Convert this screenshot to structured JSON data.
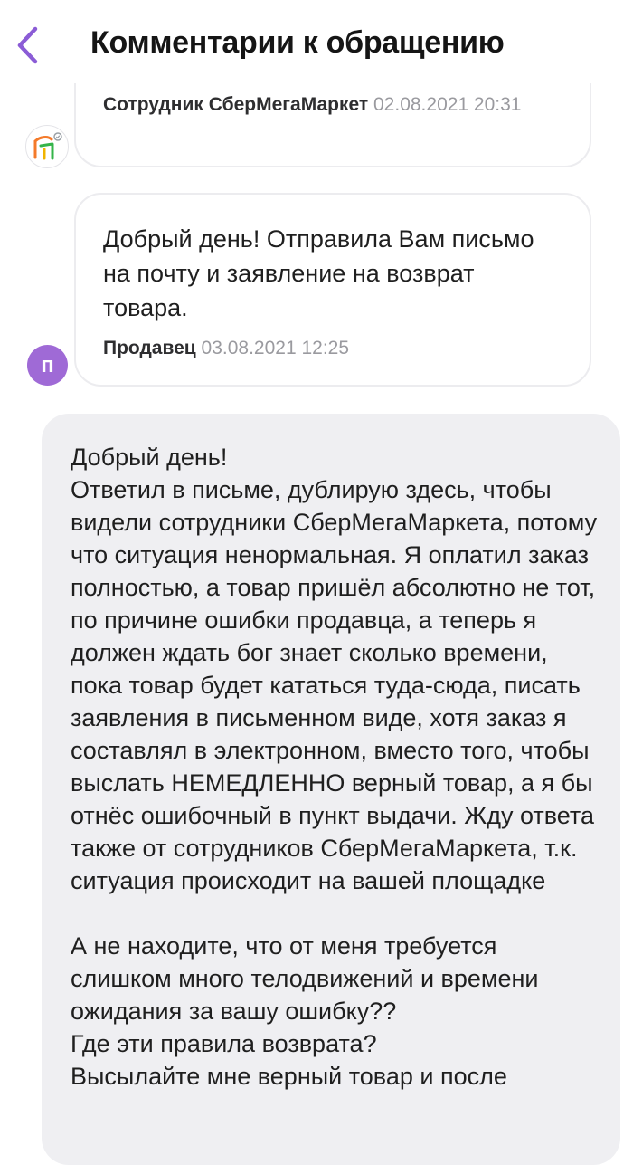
{
  "header": {
    "title": "Комментарии к обращению",
    "back_icon": "chevron-left-icon",
    "accent_color": "#8b5cd6"
  },
  "messages": [
    {
      "author": "Сотрудник СберМегаМаркет",
      "timestamp": "02.08.2021 20:31",
      "avatar_icon": "sbermegamarket-logo-icon"
    },
    {
      "text": "Добрый день! Отправила Вам письмо на почту и заявление на возврат товара.",
      "author": "Продавец",
      "timestamp": "03.08.2021 12:25",
      "avatar_letter": "п"
    }
  ],
  "my_message": {
    "text": "Добрый день!\nОтветил в письме, дублирую здесь, чтобы видели сотрудники СберМегаМаркета, потому что ситуация ненормальная. Я оплатил заказ полностью, а товар пришёл абсолютно не тот, по причине ошибки продавца, а теперь я должен ждать бог знает сколько времени, пока товар будет кататься туда-сюда, писать заявления в письменном виде, хотя заказ я составлял в электронном, вместо того, чтобы выслать НЕМЕДЛЕННО верный товар, а я бы отнёс ошибочный в пункт выдачи. Жду ответа также от сотрудников СберМегаМаркета, т.к. ситуация происходит на вашей площадке\n\nА не находите, что от меня требуется слишком много телодвижений и времени ожидания за вашу ошибку??\nГде эти правила возврата?\nВысылайте мне верный товар и после"
  }
}
